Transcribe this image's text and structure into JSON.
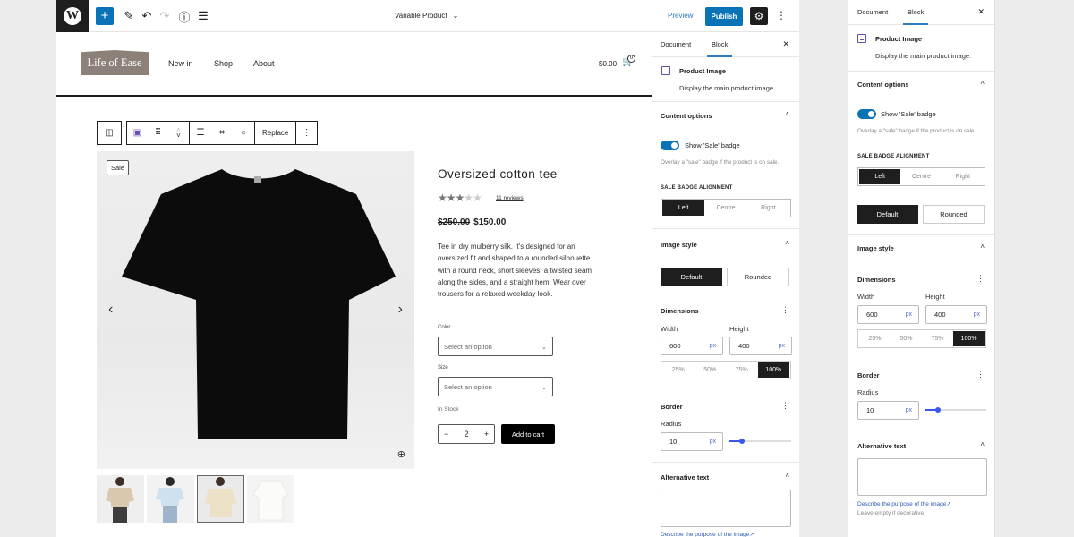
{
  "topbar": {
    "logo": "W",
    "add_block": "+",
    "document_title": "Variable Product",
    "preview": "Preview",
    "publish": "Publish",
    "icons": [
      "pencil-icon",
      "undo-icon",
      "redo-icon",
      "info-icon",
      "list-view-icon"
    ]
  },
  "site": {
    "logo_text": "Life of Ease",
    "nav": [
      "New in",
      "Shop",
      "About"
    ],
    "cart_total": "$0.00",
    "cart_count": "0"
  },
  "block_toolbar": {
    "replace": "Replace"
  },
  "product": {
    "sale_badge": "Sale",
    "title": "Oversized cotton tee",
    "rating": 3,
    "rating_max": 5,
    "reviews": "11 reviews",
    "old_price": "$250.00",
    "price": "$150.00",
    "description": "Tee in dry mulberry silk. It's designed for an oversized fit and shaped to a rounded silhouette with a round neck, short sleeves, a twisted seam along the sides, and a straight hem. Wear over trousers for a relaxed weekday look.",
    "color_label": "Color",
    "color_placeholder": "Select an option",
    "size_label": "Size",
    "size_placeholder": "Select an option",
    "stock": "In Stock",
    "quantity": "2",
    "add_to_cart": "Add to cart",
    "thumbnails": [
      {
        "name": "beige-tee-front",
        "color": "#d9c7ae"
      },
      {
        "name": "light-blue-tee",
        "color": "#cfe0ee"
      },
      {
        "name": "cream-tee-back",
        "color": "#ece0c6"
      },
      {
        "name": "white-tee",
        "color": "#f7f6f2"
      }
    ],
    "active_thumbnail": 2
  },
  "sidebar": {
    "tabs": [
      "Document",
      "Block"
    ],
    "active_tab": "Block",
    "block_name": "Product Image",
    "block_desc": "Display the main product image.",
    "content_options": {
      "title": "Content options",
      "toggle_label": "Show 'Sale' badge",
      "toggle_on": true,
      "help": "Overlay a \"sale\" badge if the product is on sale.",
      "alignment_label": "SALE BADGE ALIGNMENT",
      "alignment_options": [
        "Left",
        "Centre",
        "Right"
      ],
      "alignment_selected": "Left"
    },
    "image_style": {
      "title": "Image style",
      "options": [
        "Default",
        "Rounded"
      ],
      "selected": "Default"
    },
    "dimensions": {
      "title": "Dimensions",
      "width_label": "Width",
      "width_value": "600",
      "height_label": "Height",
      "height_value": "400",
      "unit": "px",
      "scale_options": [
        "25%",
        "50%",
        "75%",
        "100%"
      ],
      "scale_selected": "100%"
    },
    "border": {
      "title": "Border",
      "radius_label": "Radius",
      "radius_value": "10",
      "unit": "px",
      "slider_fraction": 0.2
    },
    "alt_text": {
      "title": "Alternative text",
      "value": "",
      "link": "Describe the purpose of the image↗",
      "help": "Leave empty if decorative."
    }
  }
}
